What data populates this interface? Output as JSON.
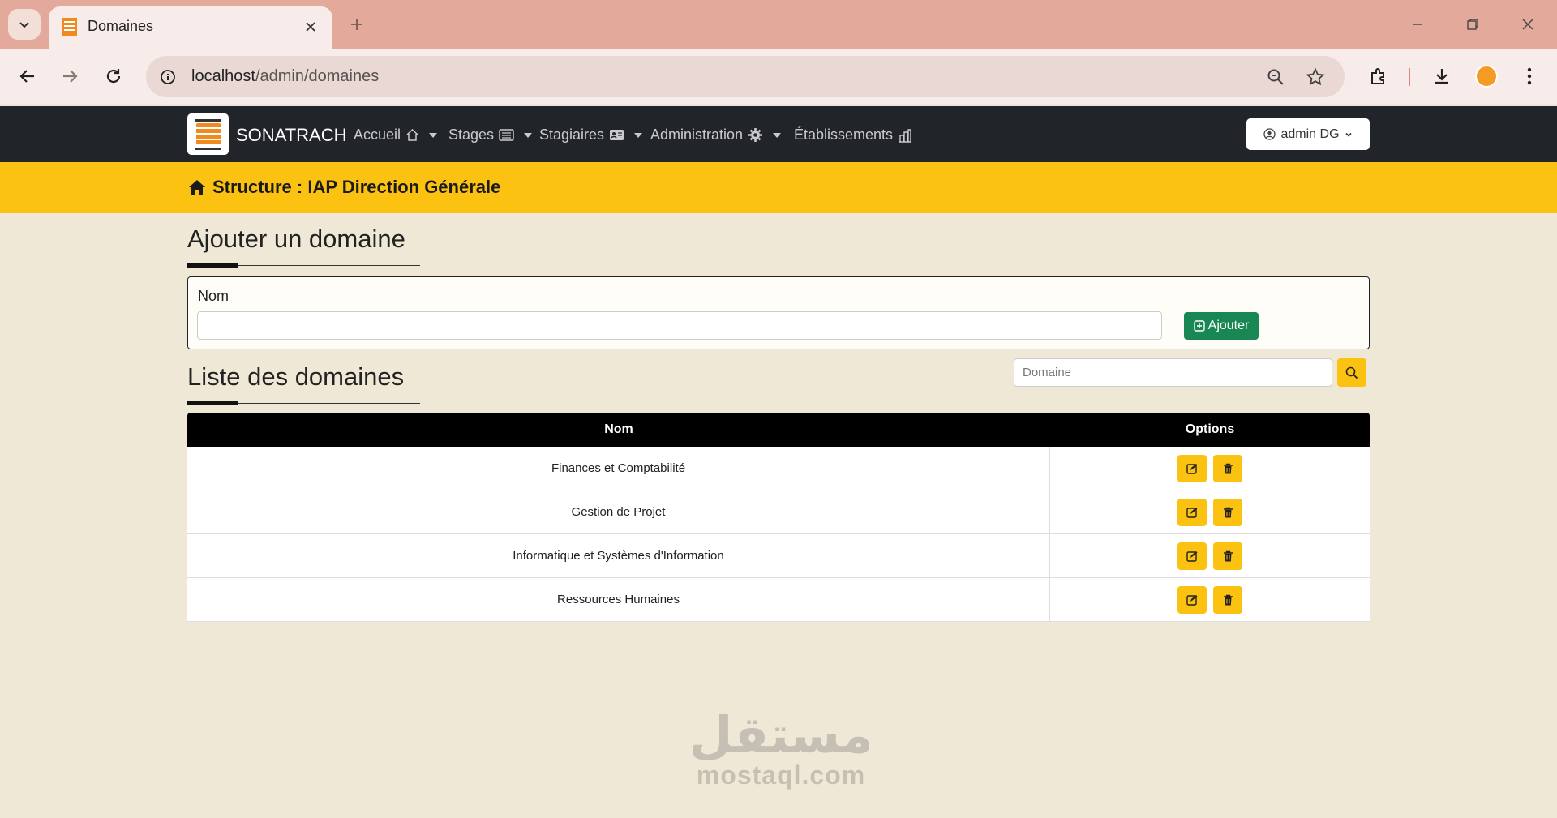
{
  "browser": {
    "tab_title": "Domaines",
    "url_host": "localhost",
    "url_path": "/admin/domaines"
  },
  "navbar": {
    "brand": "SONATRACH",
    "items": [
      {
        "label": "Accueil",
        "icon": "home-icon",
        "dropdown": true
      },
      {
        "label": "Stages",
        "icon": "list-icon",
        "dropdown": true
      },
      {
        "label": "Stagiaires",
        "icon": "id-card-icon",
        "dropdown": true
      },
      {
        "label": "Administration",
        "icon": "gear-icon",
        "dropdown": true
      },
      {
        "label": "Établissements",
        "icon": "building-icon",
        "dropdown": false
      }
    ],
    "user_label": "admin DG"
  },
  "structure": {
    "title": "Structure : IAP Direction Générale"
  },
  "add_section": {
    "title": "Ajouter un domaine",
    "field_label": "Nom",
    "field_value": "",
    "button_label": "Ajouter"
  },
  "list_section": {
    "title": "Liste des domaines",
    "search_placeholder": "Domaine",
    "columns": [
      "Nom",
      "Options"
    ],
    "rows": [
      {
        "nom": "Finances et Comptabilité"
      },
      {
        "nom": "Gestion de Projet"
      },
      {
        "nom": "Informatique et Systèmes d'Information"
      },
      {
        "nom": "Ressources Humaines"
      }
    ]
  },
  "watermark": {
    "arabic": "مستقل",
    "latin": "mostaql.com"
  },
  "colors": {
    "accent": "#fcc211",
    "success": "#198754",
    "navbar": "#212529",
    "background": "#f0e8d6"
  }
}
